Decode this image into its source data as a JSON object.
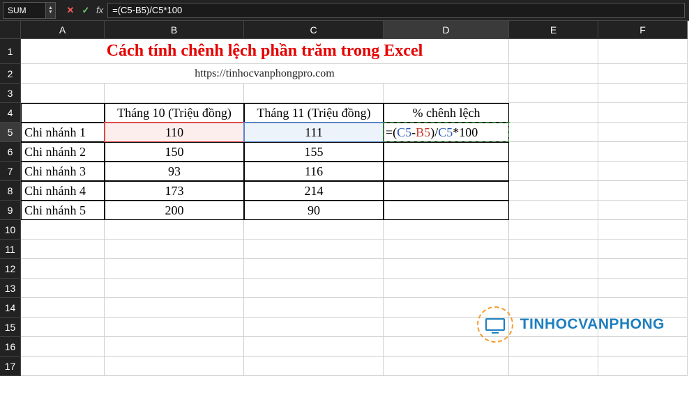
{
  "formula_bar": {
    "name_box": "SUM",
    "fx_label": "fx",
    "formula": "=(C5-B5)/C5*100"
  },
  "columns": [
    "A",
    "B",
    "C",
    "D",
    "E",
    "F"
  ],
  "rows": [
    "1",
    "2",
    "3",
    "4",
    "5",
    "6",
    "7",
    "8",
    "9",
    "10",
    "11",
    "12",
    "13",
    "14",
    "15",
    "16",
    "17"
  ],
  "selected_col": "D",
  "selected_row": "5",
  "content": {
    "title": "Cách tính chênh lệch phần trăm trong Excel",
    "subtitle": "https://tinhocvanphongpro.com",
    "headers": {
      "b4": "Tháng 10 (Triệu đồng)",
      "c4": "Tháng 11 (Triệu đồng)",
      "d4": "% chênh lệch"
    },
    "rows": [
      {
        "a": "Chi nhánh 1",
        "b": "110",
        "c": "111"
      },
      {
        "a": "Chi nhánh 2",
        "b": "150",
        "c": "155"
      },
      {
        "a": "Chi nhánh 3",
        "b": "93",
        "c": "116"
      },
      {
        "a": "Chi nhánh 4",
        "b": "173",
        "c": "214"
      },
      {
        "a": "Chi nhánh 5",
        "b": "200",
        "c": "90"
      }
    ],
    "d5_formula": {
      "eq": "=",
      "lp": "(",
      "c5a": "C5",
      "minus": "-",
      "b5": "B5",
      "rp": ")",
      "slash": "/",
      "c5b": "C5",
      "star": "*",
      "hund": "100"
    }
  },
  "watermark": {
    "text": "TINHOCVANPHONG"
  },
  "icons": {
    "cancel": "✕",
    "enter": "✓",
    "up": "▲",
    "down": "▼"
  }
}
